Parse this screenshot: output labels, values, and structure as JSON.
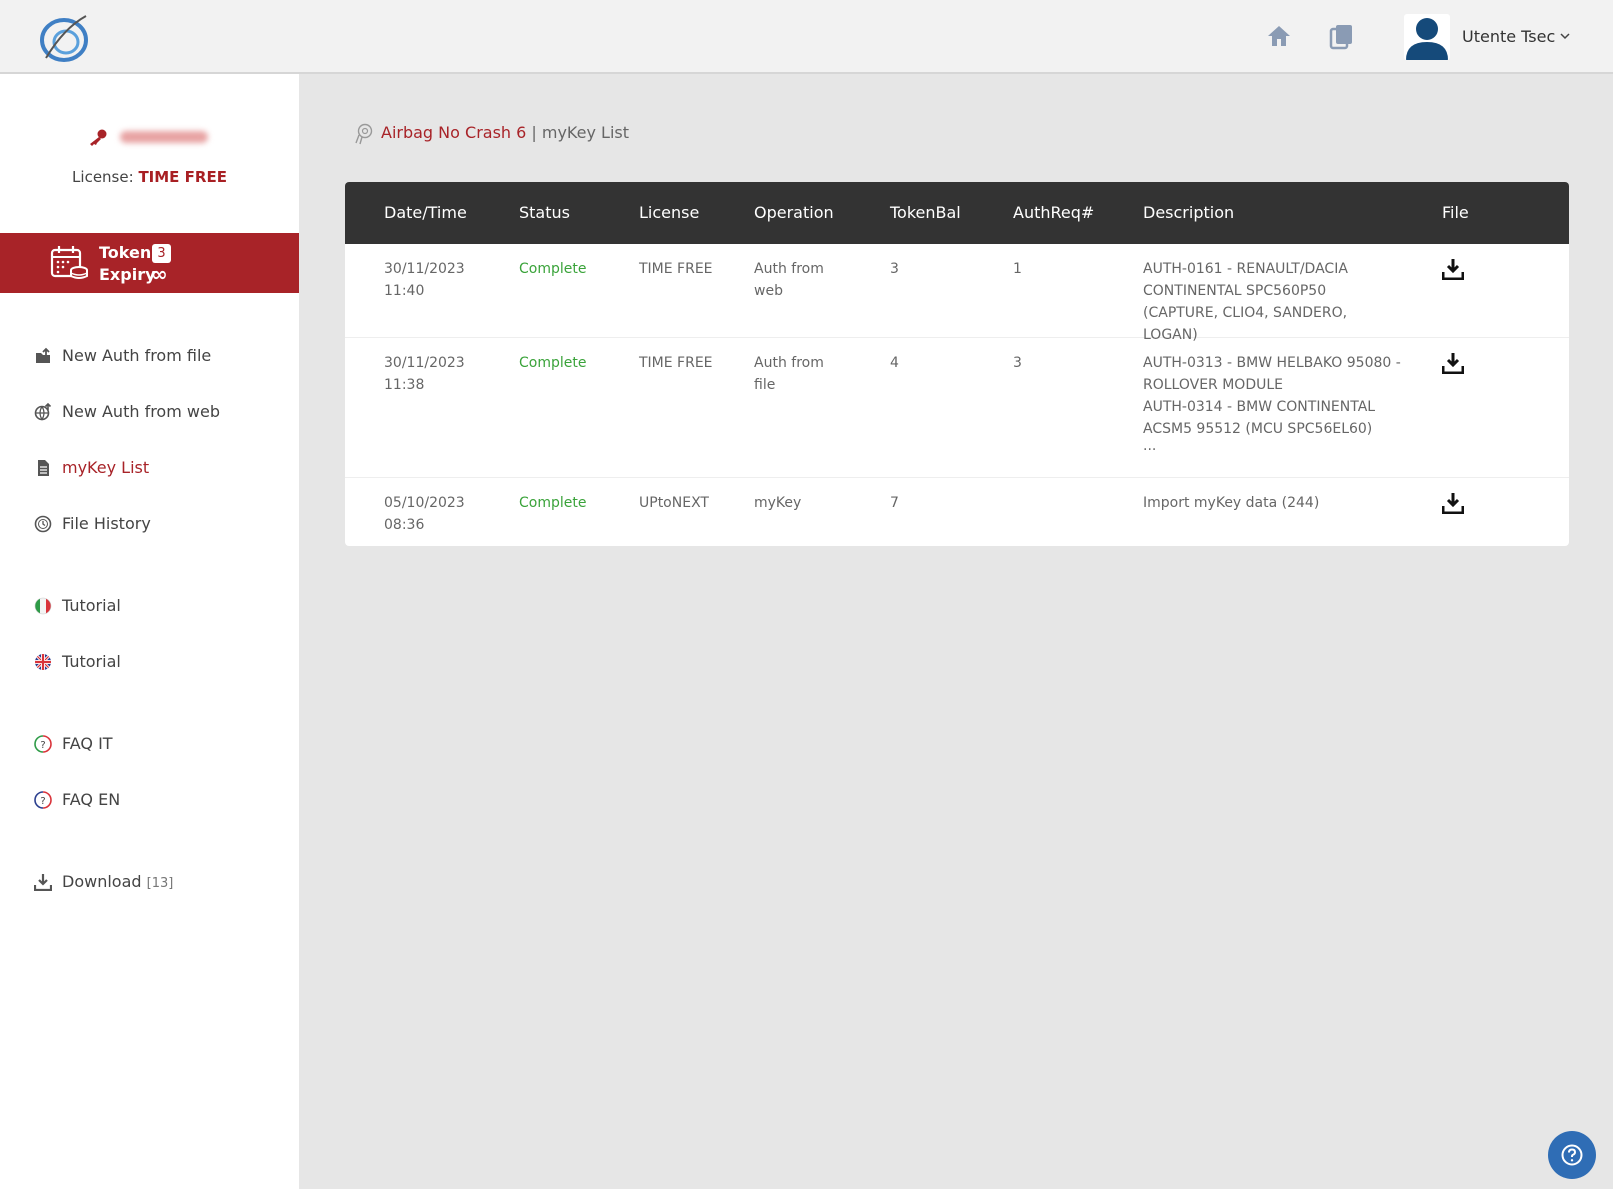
{
  "header": {
    "user_name": "Utente Tsec"
  },
  "sidebar": {
    "license_label": "License:",
    "license_value": "TIME FREE",
    "token_label": "Token",
    "token_count": "3",
    "expiry_label": "Expiry",
    "expiry_value": "∞",
    "items": [
      {
        "label": "New Auth from file"
      },
      {
        "label": "New Auth from web"
      },
      {
        "label": "myKey List"
      },
      {
        "label": "File History"
      },
      {
        "label": "Tutorial"
      },
      {
        "label": "Tutorial"
      },
      {
        "label": "FAQ IT"
      },
      {
        "label": "FAQ EN"
      },
      {
        "label": "Download",
        "count": "[13]"
      }
    ]
  },
  "breadcrumb": {
    "link": "Airbag No Crash 6",
    "separator": " | ",
    "current": "myKey List"
  },
  "table": {
    "headers": [
      "Date/Time",
      "Status",
      "License",
      "Operation",
      "TokenBal",
      "AuthReq#",
      "Description",
      "File"
    ],
    "rows": [
      {
        "date": "30/11/2023",
        "time": "11:40",
        "status": "Complete",
        "license": "TIME FREE",
        "operation_1": "Auth from",
        "operation_2": "web",
        "tokenbal": "3",
        "authreq": "1",
        "desc": [
          "AUTH-0161 - RENAULT/DACIA",
          "CONTINENTAL SPC560P50",
          "(CAPTURE, CLIO4, SANDERO, LOGAN)"
        ]
      },
      {
        "date": "30/11/2023",
        "time": "11:38",
        "status": "Complete",
        "license": "TIME FREE",
        "operation_1": "Auth from",
        "operation_2": "file",
        "tokenbal": "4",
        "authreq": "3",
        "desc": [
          "AUTH-0313 - BMW HELBAKO 95080 -",
          "ROLLOVER MODULE",
          "AUTH-0314 - BMW CONTINENTAL",
          "ACSM5 95512 (MCU SPC56EL60)",
          "..."
        ]
      },
      {
        "date": "05/10/2023",
        "time": "08:36",
        "status": "Complete",
        "license": "UPtoNEXT",
        "operation_1": "myKey",
        "operation_2": "",
        "tokenbal": "7",
        "authreq": "",
        "desc": [
          "Import myKey data (244)"
        ]
      }
    ]
  },
  "colors": {
    "brand": "#a82328",
    "status_complete": "#3aa33a",
    "header_dark": "#333333",
    "help_button": "#2f6db5"
  }
}
